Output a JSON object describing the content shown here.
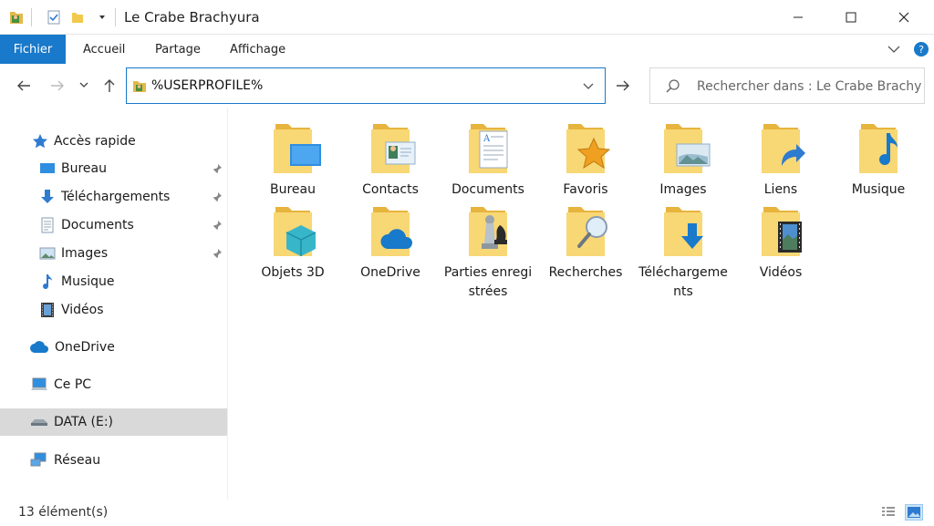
{
  "window": {
    "title": "Le Crabe Brachyura"
  },
  "ribbon": {
    "tabs": [
      "Fichier",
      "Accueil",
      "Partage",
      "Affichage"
    ]
  },
  "nav": {
    "address": "%USERPROFILE%",
    "search_placeholder": "Rechercher dans : Le Crabe Brachy..."
  },
  "sidebar": {
    "items": [
      {
        "label": "Accès rapide",
        "icon": "star-icon"
      },
      {
        "label": "Bureau",
        "icon": "desktop-icon",
        "pinned": true
      },
      {
        "label": "Téléchargements",
        "icon": "download-icon",
        "pinned": true
      },
      {
        "label": "Documents",
        "icon": "documents-icon",
        "pinned": true
      },
      {
        "label": "Images",
        "icon": "images-icon",
        "pinned": true
      },
      {
        "label": "Musique",
        "icon": "music-icon"
      },
      {
        "label": "Vidéos",
        "icon": "videos-icon"
      },
      {
        "label": "OneDrive",
        "icon": "cloud-icon"
      },
      {
        "label": "Ce PC",
        "icon": "pc-icon"
      },
      {
        "label": "DATA (E:)",
        "icon": "drive-icon",
        "selected": true
      },
      {
        "label": "Réseau",
        "icon": "network-icon"
      }
    ]
  },
  "folders": [
    {
      "label": "Bureau",
      "overlay": "desktop"
    },
    {
      "label": "Contacts",
      "overlay": "contact"
    },
    {
      "label": "Documents",
      "overlay": "document"
    },
    {
      "label": "Favoris",
      "overlay": "star"
    },
    {
      "label": "Images",
      "overlay": "image"
    },
    {
      "label": "Liens",
      "overlay": "arrow"
    },
    {
      "label": "Musique",
      "overlay": "music"
    },
    {
      "label": "Objets 3D",
      "overlay": "cube"
    },
    {
      "label": "OneDrive",
      "overlay": "cloud"
    },
    {
      "label": "Parties enregistrées",
      "overlay": "chess"
    },
    {
      "label": "Recherches",
      "overlay": "search"
    },
    {
      "label": "Téléchargements",
      "overlay": "download"
    },
    {
      "label": "Vidéos",
      "overlay": "film"
    }
  ],
  "status": {
    "count": "13 élément(s)"
  },
  "colors": {
    "accent": "#1979ca",
    "folder": "#f8d775",
    "selection": "#d9d9d9"
  }
}
